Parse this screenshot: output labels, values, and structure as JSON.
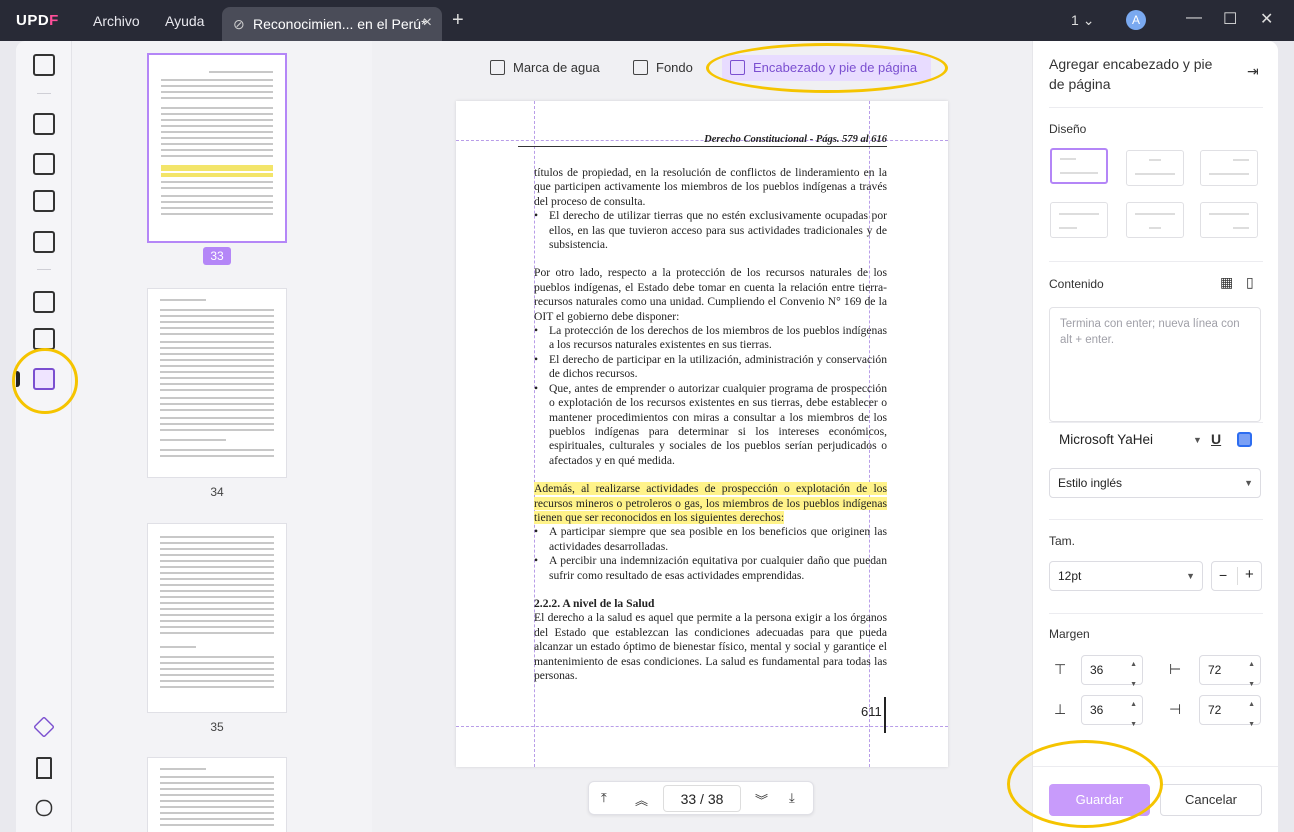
{
  "app": {
    "logo": "UPDF",
    "menu": [
      "Archivo",
      "Ayuda"
    ],
    "tab_title": "Reconocimien... en el Perú*",
    "page_indicator": "1",
    "avatar_letter": "A"
  },
  "toolbar": {
    "watermark": "Marca de agua",
    "background": "Fondo",
    "header_footer": "Encabezado y pie de página"
  },
  "thumbnails": [
    {
      "num": "33",
      "selected": true
    },
    {
      "num": "34"
    },
    {
      "num": "35"
    }
  ],
  "document": {
    "header": "Derecho Constitucional - Págs. 579 al 616",
    "blocks": [
      {
        "t": "títulos de propiedad, en la resolución de conflictos de linderamiento en la que participen activamente los miembros de los pueblos indígenas a través del proceso de consulta.",
        "cls": "ind"
      },
      {
        "t": "El derecho de utilizar tierras que no estén exclusivamente ocupadas por ellos, en las que tuvieron acceso para sus actividades tradicionales y de subsistencia.",
        "cls": "b"
      },
      {
        "t": "",
        "cls": "gap"
      },
      {
        "t": "Por otro lado, respecto a la protección de los recursos naturales de los pueblos indígenas, el Estado debe tomar en cuenta la relación entre tierra-recursos naturales como una unidad. Cumpliendo el Convenio N° 169 de la OIT el gobierno debe disponer:",
        "cls": "p"
      },
      {
        "t": "La protección de los derechos de los miembros de los pueblos indígenas a los recursos naturales existentes en sus tierras.",
        "cls": "b"
      },
      {
        "t": "El derecho de participar en la utilización, administración y conservación de dichos recursos.",
        "cls": "b"
      },
      {
        "t": "Que, antes de emprender o autorizar cualquier programa de prospección o explotación de los recursos existentes en sus tierras, debe establecer o mantener procedimientos con miras a consultar a los miembros de los pueblos indígenas para determinar si los intereses económicos, espirituales, culturales y sociales de los pueblos serían perjudicados o afectados y en qué medida.",
        "cls": "b"
      },
      {
        "t": "",
        "cls": "gap"
      },
      {
        "t": "Además, al realizarse actividades de prospección o explotación de los recursos mineros o petroleros o gas, los miembros de los pueblos indígenas tienen que ser reconocidos en los siguientes derechos:",
        "cls": "p hl"
      },
      {
        "t": "A participar siempre que sea posible en los beneficios que originen las actividades desarrolladas.",
        "cls": "b"
      },
      {
        "t": "A percibir una indemnización equitativa por cualquier daño que puedan sufrir como resultado de esas actividades emprendidas.",
        "cls": "b"
      },
      {
        "t": "",
        "cls": "gap"
      },
      {
        "t": "2.2.2. A nivel de la Salud",
        "cls": "sub"
      },
      {
        "t": "El derecho a la salud es aquel que permite a la persona exigir a los órganos del Estado que establezcan las condiciones adecuadas para que pueda alcanzar un estado óptimo de bienestar físico, mental y social y garantice el mantenimiento de esas condiciones. La salud es fundamental para todas las personas.",
        "cls": "p"
      }
    ],
    "page_number": "611"
  },
  "pager": {
    "current": "33",
    "sep": "/",
    "total": "38"
  },
  "panel": {
    "title": "Agregar encabezado y pie de página",
    "design_label": "Diseño",
    "content_label": "Contenido",
    "content_placeholder": "Termina con enter; nueva línea con alt + enter.",
    "font": "Microsoft YaHei",
    "underline": "U",
    "style": "Estilo inglés",
    "size_label": "Tam.",
    "size": "12pt",
    "minus": "−",
    "plus": "+",
    "margin_label": "Margen",
    "margin_top": "36",
    "margin_left": "72",
    "margin_bottom": "36",
    "margin_right": "72",
    "save": "Guardar",
    "cancel": "Cancelar"
  },
  "colors": {
    "accent": "#b486f7",
    "highlight_circle": "#f5c400",
    "titlebar": "#282a36"
  }
}
